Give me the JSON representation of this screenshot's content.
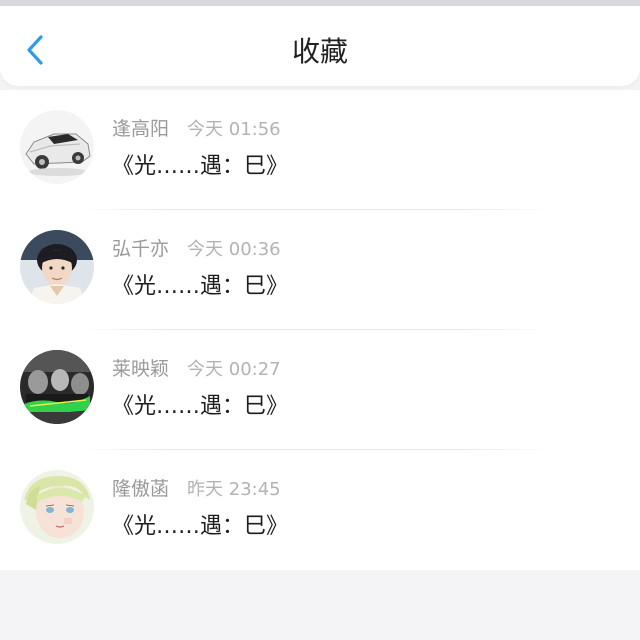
{
  "header": {
    "title": "收藏",
    "back_icon": "chevron-left-icon",
    "accent_color": "#2f9be8"
  },
  "items": [
    {
      "name": "逢高阳",
      "time": "今天 01:56",
      "content": "《光……遇：巳》",
      "avatar": "sports-car-avatar"
    },
    {
      "name": "弘千亦",
      "time": "今天 00:36",
      "content": "《光……遇：巳》",
      "avatar": "portrait-avatar"
    },
    {
      "name": "莱映颖",
      "time": "今天 00:27",
      "content": "《光……遇：巳》",
      "avatar": "group-photo-avatar"
    },
    {
      "name": "隆傲菡",
      "time": "昨天 23:45",
      "content": "《光……遇：巳》",
      "avatar": "anime-character-avatar"
    }
  ]
}
